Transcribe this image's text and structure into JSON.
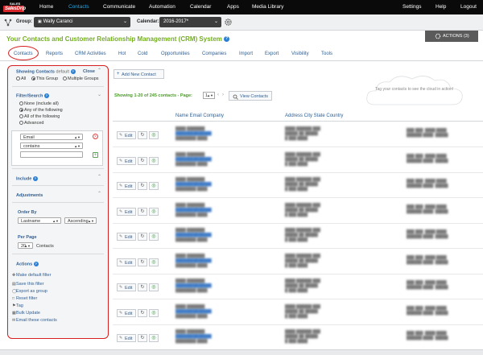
{
  "nav": {
    "logo_tag": "SALES",
    "logo_text": "SalesDrip",
    "items": [
      "Home",
      "Contacts",
      "Communicate",
      "Automation",
      "Calendar",
      "Apps",
      "Media Library"
    ],
    "right_items": [
      "Settings",
      "Help",
      "Logout"
    ],
    "active": "Contacts",
    "active_color": "#29a3e0"
  },
  "group_bar": {
    "group_label": "Group:",
    "group_value": "Wally Caranci",
    "calendar_label": "Calendar:",
    "calendar_value": "2016-2017*"
  },
  "title": {
    "text": "Your Contacts and Customer Relationship Management (CRM) System",
    "color": "#73ad21",
    "help_icon": "?"
  },
  "actions_button": "ACTIONS (3)",
  "tabs": [
    "Contacts",
    "Reports",
    "CRM Activities",
    "Hot",
    "Cold",
    "Opportunities",
    "Companies",
    "Import",
    "Export",
    "Visibility",
    "Tools"
  ],
  "left_panel": {
    "showing_label": "Showing Contacts",
    "default_label": "default",
    "close_label": "Close",
    "scope_options": [
      "All",
      "This Group",
      "Multiple Groups"
    ],
    "scope_selected": "This Group",
    "filter_label": "Filter/Search",
    "filter_options": [
      "None (include all)",
      "Any of the following",
      "All of the following",
      "Advanced"
    ],
    "filter_selected": "Any of the following",
    "field_select": "Email",
    "op_select": "contains",
    "include_label": "Include",
    "adjustments_label": "Adjustments",
    "order_by_label": "Order By",
    "order_by_field": "Lastname",
    "order_by_dir": "Ascending",
    "per_page_label": "Per Page",
    "per_page_value": "20",
    "per_page_suffix": "Contacts",
    "actions_label": "Actions",
    "actions": [
      "Make default filter",
      "Save this filter",
      "Export as group",
      "Reset filter",
      "Tag",
      "Bulk Update",
      "Email these contacts"
    ]
  },
  "content": {
    "add_new_label": "Add New Contact",
    "showing_text": "Showing 1-20 of 245 contacts - Page:",
    "page_value": "1",
    "view_contacts_label": "View Contacts",
    "cloud_text": "Tag your contacts to see the cloud in action!",
    "columns": [
      "Name Email Company",
      "Address City State Country"
    ],
    "edit_label": "Edit",
    "row_count": 9
  }
}
